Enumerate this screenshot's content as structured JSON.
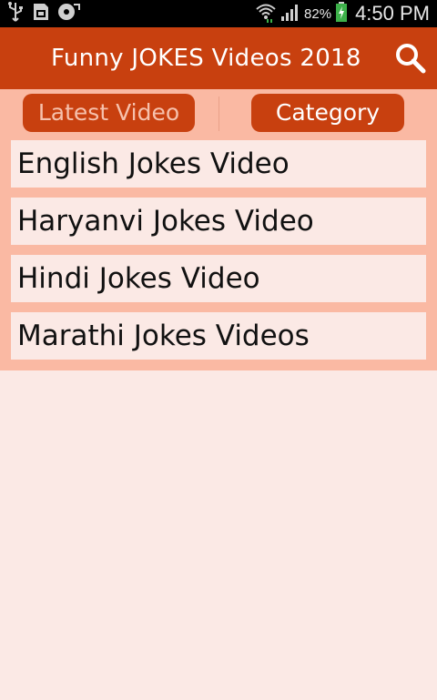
{
  "status_bar": {
    "icons_left": [
      "usb-icon",
      "sd-card-icon",
      "sync-icon"
    ],
    "battery_percent": "82%",
    "time": "4:50 PM"
  },
  "toolbar": {
    "title": "Funny JOKES Videos 2018",
    "search_icon": "search-icon"
  },
  "tabs": [
    {
      "label": "Latest Video"
    },
    {
      "label": "Category"
    }
  ],
  "list": {
    "items": [
      {
        "label": "English Jokes Video"
      },
      {
        "label": "Haryanvi Jokes Video"
      },
      {
        "label": "Hindi Jokes Video"
      },
      {
        "label": "Marathi Jokes Videos"
      }
    ]
  },
  "colors": {
    "toolbar": "#c8400f",
    "tab_panel": "#fab9a3",
    "background": "#fbe9e5",
    "battery": "#3db04a"
  }
}
